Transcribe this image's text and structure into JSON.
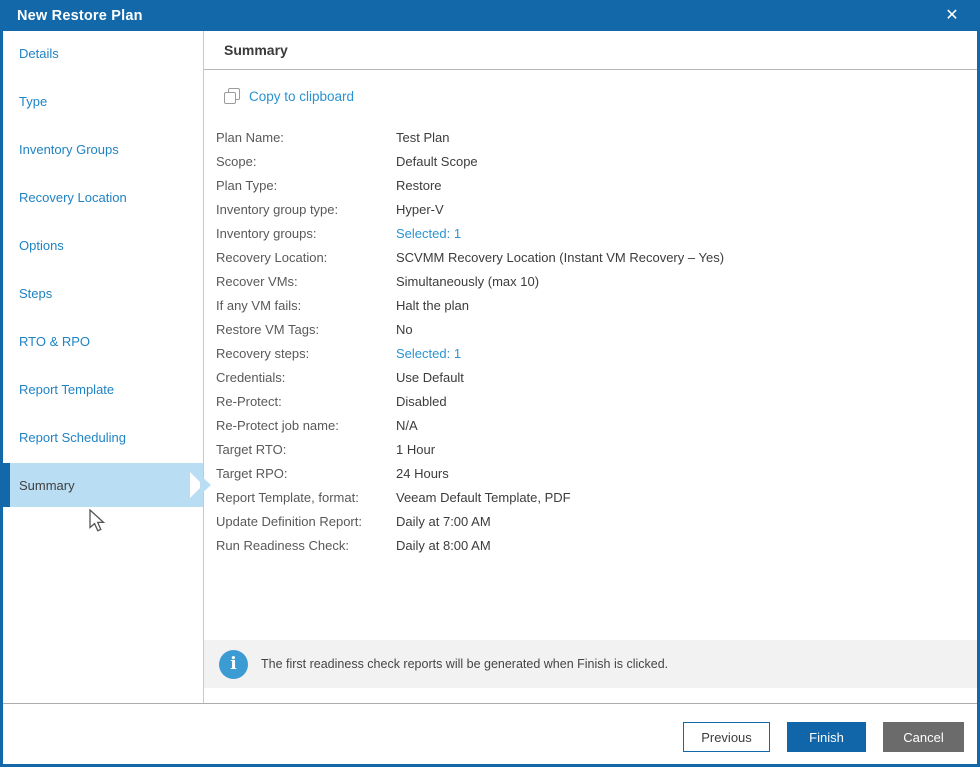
{
  "titlebar": {
    "title": "New Restore Plan"
  },
  "icons": {
    "close": "✕",
    "info": "i",
    "copy": "copy-overlapping-squares"
  },
  "sidebar": {
    "items": [
      {
        "label": "Details",
        "selected": false
      },
      {
        "label": "Type",
        "selected": false
      },
      {
        "label": "Inventory Groups",
        "selected": false
      },
      {
        "label": "Recovery Location",
        "selected": false
      },
      {
        "label": "Options",
        "selected": false
      },
      {
        "label": "Steps",
        "selected": false
      },
      {
        "label": "RTO & RPO",
        "selected": false
      },
      {
        "label": "Report Template",
        "selected": false
      },
      {
        "label": "Report Scheduling",
        "selected": false
      },
      {
        "label": "Summary",
        "selected": true
      }
    ]
  },
  "content": {
    "heading": "Summary",
    "copy_to_clipboard": "Copy to clipboard",
    "rows": [
      {
        "label": "Plan Name:",
        "value": "Test Plan",
        "is_link": false
      },
      {
        "label": "Scope:",
        "value": "Default Scope",
        "is_link": false
      },
      {
        "label": "Plan Type:",
        "value": "Restore",
        "is_link": false
      },
      {
        "label": "Inventory group type:",
        "value": "Hyper-V",
        "is_link": false
      },
      {
        "label": "Inventory groups:",
        "value": "Selected: 1",
        "is_link": true
      },
      {
        "label": "Recovery Location:",
        "value": "SCVMM Recovery Location (Instant VM Recovery – Yes)",
        "is_link": false
      },
      {
        "label": "Recover VMs:",
        "value": "Simultaneously (max 10)",
        "is_link": false
      },
      {
        "label": "If any VM fails:",
        "value": "Halt the plan",
        "is_link": false
      },
      {
        "label": "Restore VM Tags:",
        "value": "No",
        "is_link": false
      },
      {
        "label": "Recovery steps:",
        "value": "Selected: 1",
        "is_link": true
      },
      {
        "label": "Credentials:",
        "value": "Use Default",
        "is_link": false
      },
      {
        "label": "Re-Protect:",
        "value": "Disabled",
        "is_link": false
      },
      {
        "label": "Re-Protect job name:",
        "value": "N/A",
        "is_link": false
      },
      {
        "label": "Target RTO:",
        "value": "1 Hour",
        "is_link": false
      },
      {
        "label": "Target RPO:",
        "value": "24 Hours",
        "is_link": false
      },
      {
        "label": "Report Template, format:",
        "value": "Veeam Default Template, PDF",
        "is_link": false
      },
      {
        "label": "Update Definition Report:",
        "value": "Daily at 7:00 AM",
        "is_link": false
      },
      {
        "label": "Run Readiness Check:",
        "value": "Daily at 8:00 AM",
        "is_link": false
      }
    ],
    "info_banner": "The first readiness check reports will be generated when Finish is clicked."
  },
  "footer": {
    "previous": "Previous",
    "finish": "Finish",
    "cancel": "Cancel"
  },
  "colors": {
    "titlebar_blue": "#1268a8",
    "selected_item_bg": "#b9ddf3",
    "sidebar_link_blue": "#1f83c4",
    "content_link_blue": "#2a93d1",
    "finish_button_blue": "#1066a8",
    "cancel_button_gray": "#6b6b6b",
    "banner_bg": "#f2f2f2",
    "info_icon_blue": "#3d9bd4"
  }
}
